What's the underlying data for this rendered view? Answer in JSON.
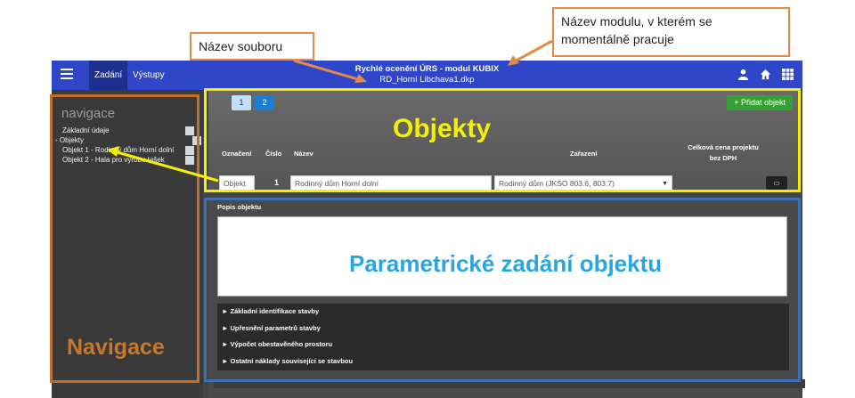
{
  "annotations": {
    "file_name_label": "Název souboru",
    "module_label": "Název modulu, v kterém se momentálně pracuje",
    "objects_label": "Objekty",
    "parametric_label": "Parametrické zadání objektu",
    "navigation_label": "Navigace"
  },
  "colors": {
    "orange_annotation": "#e38a4a",
    "yellow_highlight": "#f4f000",
    "blue_highlight": "#3c6fb4",
    "topbar": "#2f46c8",
    "parametric_text": "#27a7e0",
    "navigation_text": "#c8782a"
  },
  "toolbar": {
    "tabs": [
      "Zadání",
      "Výstupy"
    ],
    "title_line1": "Rychlé ocenění ÚRS - modul KUBIX",
    "title_line2": "RD_Horní Libchava1.dkp",
    "icons": [
      "user-icon",
      "home-icon",
      "grid-icon"
    ]
  },
  "sidebar": {
    "heading": "navigace",
    "items": [
      "Základní údaje",
      "- Objekty",
      "Objekt 1 - Rodinný dům Horní dolní",
      "Objekt 2 - Hala pro výrobu tašek"
    ]
  },
  "objects_panel": {
    "pages": [
      "1",
      "2"
    ],
    "add_button": "+ Přidat objekt",
    "headers": {
      "oznaceni": "Označení",
      "cislo": "Číslo",
      "nazev": "Název",
      "zarazeni": "Zařazení",
      "cena_line1": "Celková cena projektu",
      "cena_line2": "bez DPH"
    },
    "row": {
      "oznaceni": "Objekt",
      "cislo": "1",
      "nazev": "Rodinný dům Horní dolní",
      "zarazeni": "Rodinný dům (JKSO 803.6, 803.7)"
    }
  },
  "detail_panel": {
    "popis_label": "Popis objektu",
    "accordion": [
      "► Základní identifikace stavby",
      "► Upřesnění parametrů stavby",
      "► Výpočet obestavěného prostoru",
      "► Ostatní náklady související se stavbou"
    ]
  }
}
